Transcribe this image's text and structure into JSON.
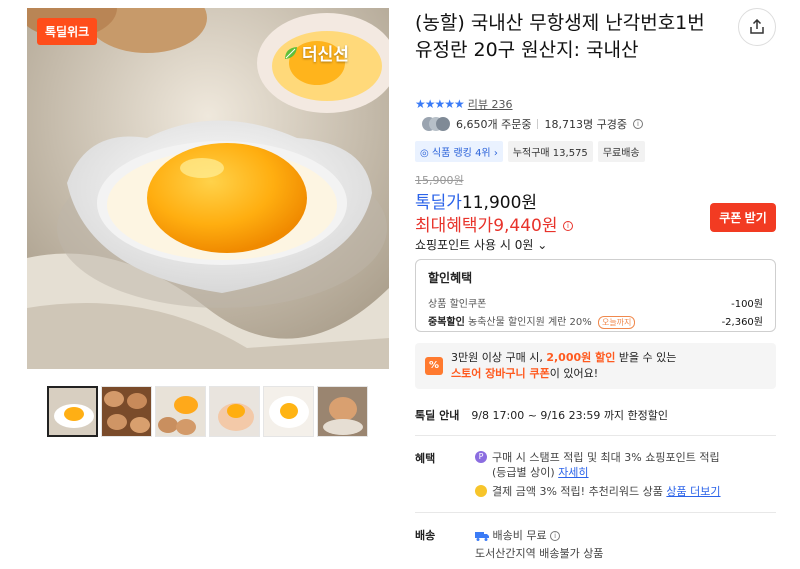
{
  "product": {
    "badge": "톡딜위크",
    "brand_logo": "더신선",
    "title": "(농할) 국내산 무항생제 난각번호1번 유정란 20구 원산지: 국내산",
    "review_label": "리뷰 236",
    "orders": "6,650개 주문중",
    "subscribers": "18,713명 구경중",
    "tags": [
      "식품 랭킹 4위",
      "누적구매 13,575",
      "무료배송"
    ],
    "original_price": "15,900원",
    "deal_label": "톡딜가",
    "deal_price": "11,900원",
    "max_benefit_label": "최대혜택가",
    "max_benefit_price": "9,440원",
    "coupon_button": "쿠폰 받기",
    "points_text": "쇼핑포인트 사용 시 0원"
  },
  "discount": {
    "header": "할인혜택",
    "rows": [
      {
        "label": "상품 할인쿠폰",
        "amount": "-100원"
      },
      {
        "label_bold": "중복할인",
        "label": "농축산물 할인지원 계란 20%",
        "pill": "오늘까지",
        "amount": "-2,360원"
      }
    ]
  },
  "promo": {
    "icon": "%",
    "line1_a": "3만원 이상 구매 시,",
    "line1_hl": "2,000원 할인",
    "line1_b": "받을 수 있는",
    "line2_hl": "스토어 장바구니 쿠폰",
    "line2_b": "이 있어요!"
  },
  "tokdeal_info": {
    "key": "톡딜 안내",
    "value": "9/8 17:00 ~ 9/16 23:59 까지 한정할인"
  },
  "benefit": {
    "key": "혜택",
    "item1": "구매 시 스탬프 적립 및 최대 3% 쇼핑포인트 적립",
    "item1_sub": "(등급별 상이)",
    "item1_link": "자세히",
    "item2": "결제 금액 3% 적립! 추천리워드 상품",
    "item2_link": "상품 더보기"
  },
  "delivery": {
    "key": "배송",
    "fee": "배송비 무료",
    "note": "도서산간지역 배송불가 상품"
  },
  "colors": {
    "accent_blue": "#2b63e9",
    "accent_red": "#e8332b",
    "coupon_orange": "#f23b22"
  }
}
